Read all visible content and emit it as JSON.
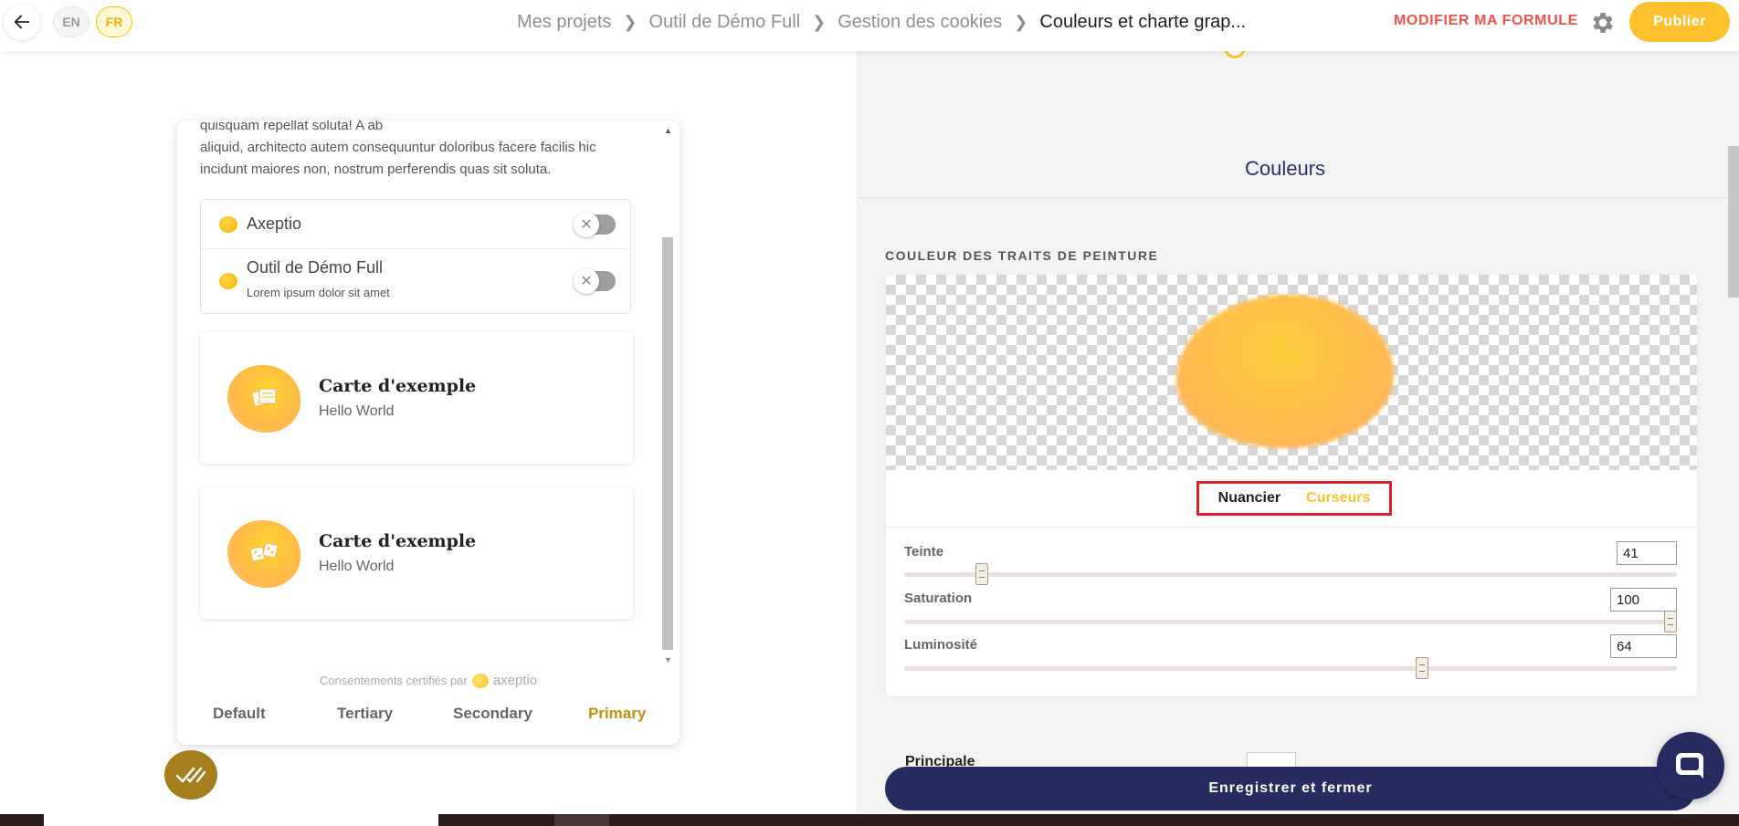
{
  "header": {
    "lang_en": "EN",
    "lang_fr": "FR",
    "breadcrumb": [
      "Mes projets",
      "Outil de Démo Full",
      "Gestion des cookies",
      "Couleurs et charte grap..."
    ],
    "modifier_label": "MODIFIER MA FORMULE",
    "publish_label": "Publier"
  },
  "preview": {
    "text_line1": "quisquam repellat soluta! A ab",
    "text_line2": "aliquid, architecto autem consequuntur doloribus facere facilis hic",
    "text_line3": "incidunt maiores non, nostrum perferendis quas sit soluta.",
    "preferences": [
      {
        "title": "Axeptio",
        "subtitle": ""
      },
      {
        "title": "Outil de Démo Full",
        "subtitle": "Lorem ipsum dolor sit amet"
      }
    ],
    "cards": [
      {
        "title": "Carte d'exemple",
        "subtitle": "Hello World"
      },
      {
        "title": "Carte d'exemple",
        "subtitle": "Hello World"
      }
    ],
    "certified_label": "Consentements certifiés par",
    "certified_brand": "axeptio",
    "tabs": [
      "Default",
      "Tertiary",
      "Secondary",
      "Primary"
    ],
    "active_tab": "Primary"
  },
  "panel": {
    "title": "Couleurs",
    "section_label": "COULEUR DES TRAITS DE PEINTURE",
    "mode_nuancier": "Nuancier",
    "mode_curseurs": "Curseurs",
    "sliders": [
      {
        "label": "Teinte",
        "value": "41",
        "fraction": 0.1
      },
      {
        "label": "Saturation",
        "value": "100",
        "fraction": 1.0
      },
      {
        "label": "Luminosité",
        "value": "64",
        "fraction": 0.67
      }
    ],
    "next_label": "Principale",
    "save_label": "Enregistrer et fermer"
  },
  "colors": {
    "accent": "#fcc12d",
    "danger": "#f0524f",
    "navy": "#262b60",
    "highlight_box": "#e01e2e"
  },
  "icons": [
    "arrow-left-icon",
    "chevron-right-icon",
    "gear-icon",
    "toggle-x-icon",
    "checkmarks-icon",
    "chat-bubble-icon"
  ]
}
